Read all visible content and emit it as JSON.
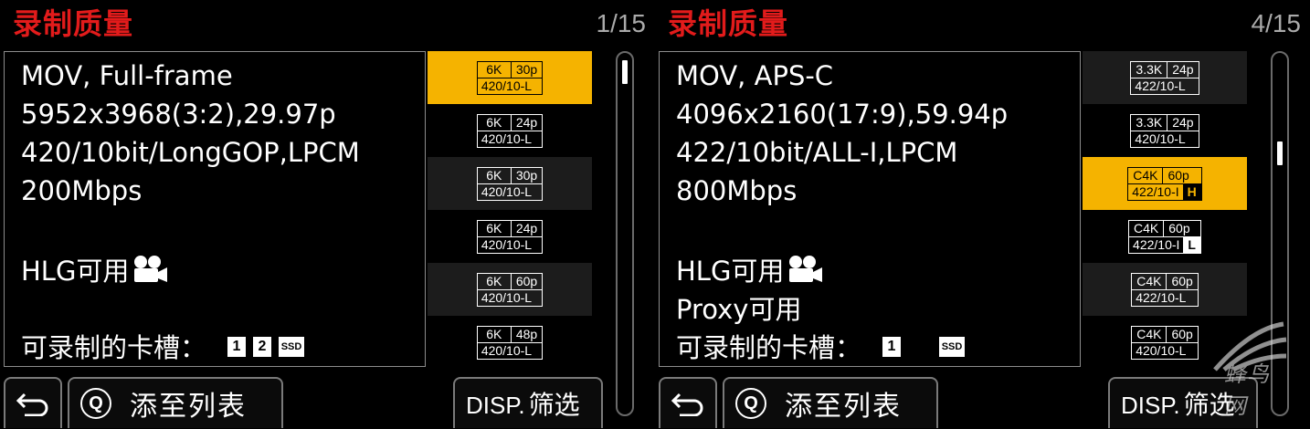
{
  "screens": [
    {
      "title": "录制质量",
      "page": "1/15",
      "info": {
        "line1": "MOV, Full-frame",
        "line2": "5952x3968(3:2),29.97p",
        "line3": "420/10bit/LongGOP,LPCM",
        "line4": "200Mbps",
        "hlg": "HLG可用",
        "proxy": "",
        "slots_label": "可录制的卡槽：",
        "slots": [
          "1",
          "2",
          "SSD"
        ]
      },
      "list": [
        {
          "res": "6K",
          "fps": "30p",
          "fmt": "420/10-L",
          "hl": "",
          "selected": true
        },
        {
          "res": "6K",
          "fps": "24p",
          "fmt": "420/10-L",
          "hl": "",
          "selected": false
        },
        {
          "res": "6K",
          "fps": "30p",
          "fmt": "420/10-L",
          "hl": "",
          "selected": false
        },
        {
          "res": "6K",
          "fps": "24p",
          "fmt": "420/10-L",
          "hl": "",
          "selected": false
        },
        {
          "res": "6K",
          "fps": "60p",
          "fmt": "420/10-L",
          "hl": "",
          "selected": false
        },
        {
          "res": "6K",
          "fps": "48p",
          "fmt": "420/10-L",
          "hl": "",
          "selected": false
        }
      ],
      "scroll_position": 0.0
    },
    {
      "title": "录制质量",
      "page": "4/15",
      "info": {
        "line1": "MOV, APS-C",
        "line2": "4096x2160(17:9),59.94p",
        "line3": "422/10bit/ALL-I,LPCM",
        "line4": "800Mbps",
        "hlg": "HLG可用",
        "proxy": "Proxy可用",
        "slots_label": "可录制的卡槽：",
        "slots": [
          "1",
          "SSD"
        ]
      },
      "list": [
        {
          "res": "3.3K",
          "fps": "24p",
          "fmt": "422/10-L",
          "hl": "",
          "selected": false
        },
        {
          "res": "3.3K",
          "fps": "24p",
          "fmt": "420/10-L",
          "hl": "",
          "selected": false
        },
        {
          "res": "C4K",
          "fps": "60p",
          "fmt": "422/10-I",
          "hl": "H",
          "selected": true
        },
        {
          "res": "C4K",
          "fps": "60p",
          "fmt": "422/10-I",
          "hl": "L",
          "selected": false
        },
        {
          "res": "C4K",
          "fps": "60p",
          "fmt": "422/10-L",
          "hl": "",
          "selected": false
        },
        {
          "res": "C4K",
          "fps": "60p",
          "fmt": "420/10-L",
          "hl": "",
          "selected": false
        }
      ],
      "scroll_position": 0.25
    }
  ],
  "buttons": {
    "back_icon": "return-arrow-icon",
    "q_key": "Q",
    "add_to_list": "添至列表",
    "disp_key": "DISP.",
    "filter": "筛选"
  },
  "watermark": {
    "text": "蜂鸟网"
  },
  "colors": {
    "title": "#e21b1b",
    "selected": "#f5b300",
    "background": "#000000"
  }
}
